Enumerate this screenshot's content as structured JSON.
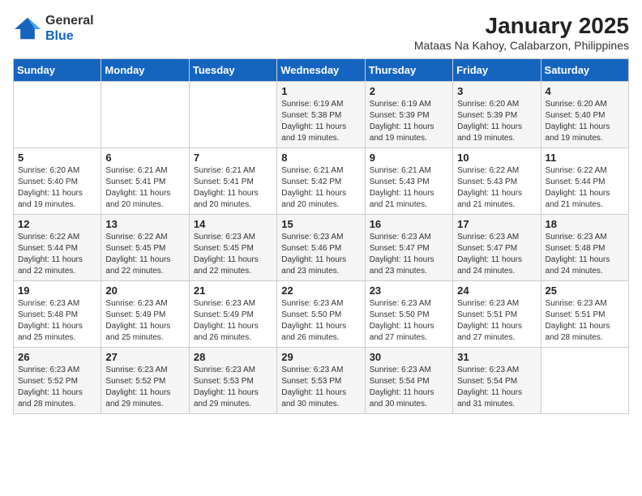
{
  "app": {
    "name_general": "General",
    "name_blue": "Blue"
  },
  "title": "January 2025",
  "subtitle": "Mataas Na Kahoy, Calabarzon, Philippines",
  "days_of_week": [
    "Sunday",
    "Monday",
    "Tuesday",
    "Wednesday",
    "Thursday",
    "Friday",
    "Saturday"
  ],
  "weeks": [
    [
      {
        "day": "",
        "sunrise": "",
        "sunset": "",
        "daylight": ""
      },
      {
        "day": "",
        "sunrise": "",
        "sunset": "",
        "daylight": ""
      },
      {
        "day": "",
        "sunrise": "",
        "sunset": "",
        "daylight": ""
      },
      {
        "day": "1",
        "sunrise": "Sunrise: 6:19 AM",
        "sunset": "Sunset: 5:38 PM",
        "daylight": "Daylight: 11 hours and 19 minutes."
      },
      {
        "day": "2",
        "sunrise": "Sunrise: 6:19 AM",
        "sunset": "Sunset: 5:39 PM",
        "daylight": "Daylight: 11 hours and 19 minutes."
      },
      {
        "day": "3",
        "sunrise": "Sunrise: 6:20 AM",
        "sunset": "Sunset: 5:39 PM",
        "daylight": "Daylight: 11 hours and 19 minutes."
      },
      {
        "day": "4",
        "sunrise": "Sunrise: 6:20 AM",
        "sunset": "Sunset: 5:40 PM",
        "daylight": "Daylight: 11 hours and 19 minutes."
      }
    ],
    [
      {
        "day": "5",
        "sunrise": "Sunrise: 6:20 AM",
        "sunset": "Sunset: 5:40 PM",
        "daylight": "Daylight: 11 hours and 19 minutes."
      },
      {
        "day": "6",
        "sunrise": "Sunrise: 6:21 AM",
        "sunset": "Sunset: 5:41 PM",
        "daylight": "Daylight: 11 hours and 20 minutes."
      },
      {
        "day": "7",
        "sunrise": "Sunrise: 6:21 AM",
        "sunset": "Sunset: 5:41 PM",
        "daylight": "Daylight: 11 hours and 20 minutes."
      },
      {
        "day": "8",
        "sunrise": "Sunrise: 6:21 AM",
        "sunset": "Sunset: 5:42 PM",
        "daylight": "Daylight: 11 hours and 20 minutes."
      },
      {
        "day": "9",
        "sunrise": "Sunrise: 6:21 AM",
        "sunset": "Sunset: 5:43 PM",
        "daylight": "Daylight: 11 hours and 21 minutes."
      },
      {
        "day": "10",
        "sunrise": "Sunrise: 6:22 AM",
        "sunset": "Sunset: 5:43 PM",
        "daylight": "Daylight: 11 hours and 21 minutes."
      },
      {
        "day": "11",
        "sunrise": "Sunrise: 6:22 AM",
        "sunset": "Sunset: 5:44 PM",
        "daylight": "Daylight: 11 hours and 21 minutes."
      }
    ],
    [
      {
        "day": "12",
        "sunrise": "Sunrise: 6:22 AM",
        "sunset": "Sunset: 5:44 PM",
        "daylight": "Daylight: 11 hours and 22 minutes."
      },
      {
        "day": "13",
        "sunrise": "Sunrise: 6:22 AM",
        "sunset": "Sunset: 5:45 PM",
        "daylight": "Daylight: 11 hours and 22 minutes."
      },
      {
        "day": "14",
        "sunrise": "Sunrise: 6:23 AM",
        "sunset": "Sunset: 5:45 PM",
        "daylight": "Daylight: 11 hours and 22 minutes."
      },
      {
        "day": "15",
        "sunrise": "Sunrise: 6:23 AM",
        "sunset": "Sunset: 5:46 PM",
        "daylight": "Daylight: 11 hours and 23 minutes."
      },
      {
        "day": "16",
        "sunrise": "Sunrise: 6:23 AM",
        "sunset": "Sunset: 5:47 PM",
        "daylight": "Daylight: 11 hours and 23 minutes."
      },
      {
        "day": "17",
        "sunrise": "Sunrise: 6:23 AM",
        "sunset": "Sunset: 5:47 PM",
        "daylight": "Daylight: 11 hours and 24 minutes."
      },
      {
        "day": "18",
        "sunrise": "Sunrise: 6:23 AM",
        "sunset": "Sunset: 5:48 PM",
        "daylight": "Daylight: 11 hours and 24 minutes."
      }
    ],
    [
      {
        "day": "19",
        "sunrise": "Sunrise: 6:23 AM",
        "sunset": "Sunset: 5:48 PM",
        "daylight": "Daylight: 11 hours and 25 minutes."
      },
      {
        "day": "20",
        "sunrise": "Sunrise: 6:23 AM",
        "sunset": "Sunset: 5:49 PM",
        "daylight": "Daylight: 11 hours and 25 minutes."
      },
      {
        "day": "21",
        "sunrise": "Sunrise: 6:23 AM",
        "sunset": "Sunset: 5:49 PM",
        "daylight": "Daylight: 11 hours and 26 minutes."
      },
      {
        "day": "22",
        "sunrise": "Sunrise: 6:23 AM",
        "sunset": "Sunset: 5:50 PM",
        "daylight": "Daylight: 11 hours and 26 minutes."
      },
      {
        "day": "23",
        "sunrise": "Sunrise: 6:23 AM",
        "sunset": "Sunset: 5:50 PM",
        "daylight": "Daylight: 11 hours and 27 minutes."
      },
      {
        "day": "24",
        "sunrise": "Sunrise: 6:23 AM",
        "sunset": "Sunset: 5:51 PM",
        "daylight": "Daylight: 11 hours and 27 minutes."
      },
      {
        "day": "25",
        "sunrise": "Sunrise: 6:23 AM",
        "sunset": "Sunset: 5:51 PM",
        "daylight": "Daylight: 11 hours and 28 minutes."
      }
    ],
    [
      {
        "day": "26",
        "sunrise": "Sunrise: 6:23 AM",
        "sunset": "Sunset: 5:52 PM",
        "daylight": "Daylight: 11 hours and 28 minutes."
      },
      {
        "day": "27",
        "sunrise": "Sunrise: 6:23 AM",
        "sunset": "Sunset: 5:52 PM",
        "daylight": "Daylight: 11 hours and 29 minutes."
      },
      {
        "day": "28",
        "sunrise": "Sunrise: 6:23 AM",
        "sunset": "Sunset: 5:53 PM",
        "daylight": "Daylight: 11 hours and 29 minutes."
      },
      {
        "day": "29",
        "sunrise": "Sunrise: 6:23 AM",
        "sunset": "Sunset: 5:53 PM",
        "daylight": "Daylight: 11 hours and 30 minutes."
      },
      {
        "day": "30",
        "sunrise": "Sunrise: 6:23 AM",
        "sunset": "Sunset: 5:54 PM",
        "daylight": "Daylight: 11 hours and 30 minutes."
      },
      {
        "day": "31",
        "sunrise": "Sunrise: 6:23 AM",
        "sunset": "Sunset: 5:54 PM",
        "daylight": "Daylight: 11 hours and 31 minutes."
      },
      {
        "day": "",
        "sunrise": "",
        "sunset": "",
        "daylight": ""
      }
    ]
  ]
}
